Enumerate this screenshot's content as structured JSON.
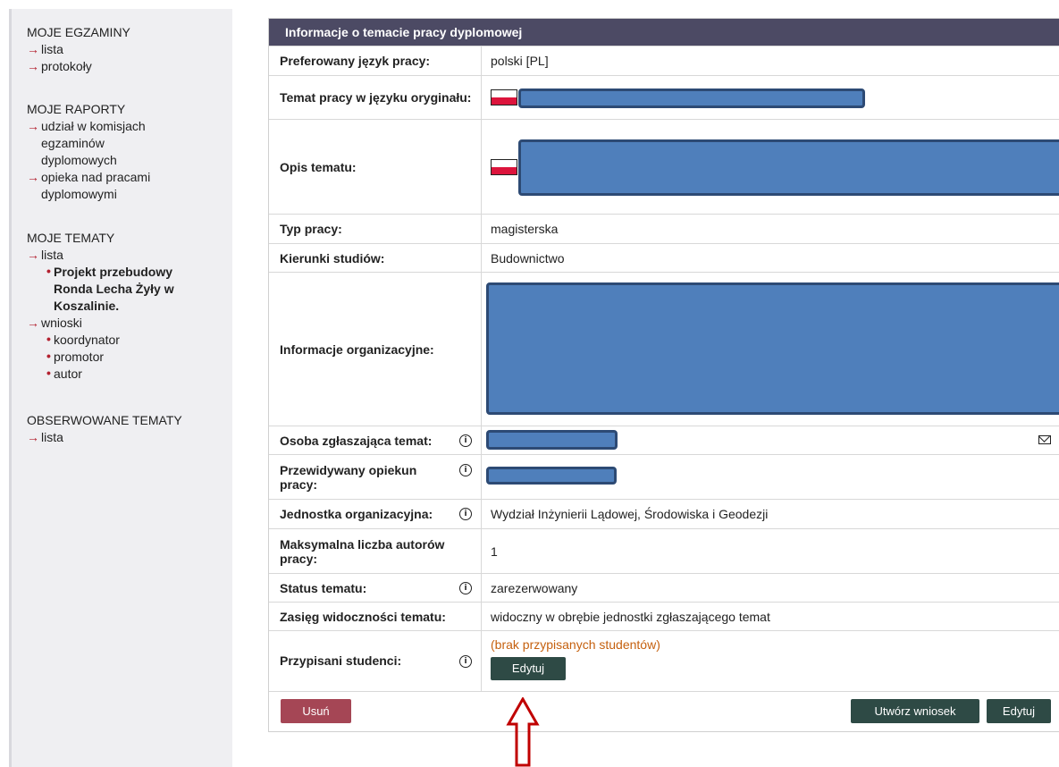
{
  "sidebar": {
    "sections": [
      {
        "title": "MOJE EGZAMINY",
        "links": [
          "lista",
          "protokoły"
        ]
      },
      {
        "title": "MOJE RAPORTY",
        "links": [
          "udział w komisjach egzaminów dyplomowych",
          "opieka nad pracami dyplomowymi"
        ]
      },
      {
        "title": "MOJE TEMATY",
        "link_lista": "lista",
        "current": "Projekt przebudowy Ronda Lecha Żyły w Koszalinie.",
        "link_wnioski": "wnioski",
        "subs": [
          "koordynator",
          "promotor",
          "autor"
        ]
      },
      {
        "title": "OBSERWOWANE TEMATY",
        "links": [
          "lista"
        ]
      }
    ],
    "raporty_lines": [
      "udział w komisjach",
      "egzaminów",
      "dyplomowych"
    ],
    "raporty_lines2": [
      "opieka nad pracami",
      "dyplomowymi"
    ],
    "current_lines": [
      "Projekt przebudowy",
      "Ronda Lecha Żyły w",
      "Koszalinie."
    ]
  },
  "panel": {
    "header": "Informacje o temacie pracy dyplomowej",
    "rows": {
      "jezyk": {
        "label": "Preferowany język pracy:",
        "value": "polski [PL]"
      },
      "temat": {
        "label": "Temat pracy w języku oryginału:"
      },
      "opis": {
        "label": "Opis tematu:"
      },
      "typ": {
        "label": "Typ pracy:",
        "value": "magisterska"
      },
      "kierunki": {
        "label": "Kierunki studiów:",
        "value": "Budownictwo"
      },
      "info_org": {
        "label": "Informacje organizacyjne:"
      },
      "osoba": {
        "label": "Osoba zgłaszająca temat:"
      },
      "opiekun": {
        "label": "Przewidywany opiekun pracy:"
      },
      "jednostka": {
        "label": "Jednostka organizacyjna:",
        "value": "Wydział Inżynierii Lądowej, Środowiska i Geodezji"
      },
      "max_autorow": {
        "label": "Maksymalna liczba autorów pracy:",
        "value": "1"
      },
      "status": {
        "label": "Status tematu:",
        "value": "zarezerwowany"
      },
      "zasieg": {
        "label": "Zasięg widoczności tematu:",
        "value": "widoczny w obrębie jednostki zgłaszającego temat"
      },
      "studenci": {
        "label": "Przypisani studenci:",
        "value": "(brak przypisanych studentów)",
        "button": "Edytuj"
      }
    },
    "footer": {
      "delete": "Usuń",
      "create_request": "Utwórz wniosek",
      "edit": "Edytuj"
    }
  },
  "colors": {
    "header_bg": "#4c4a64",
    "dark_button": "#2e4a45",
    "delete_button": "#a54655",
    "link_arrow": "#b3202f",
    "notice": "#c5600e",
    "redaction": "#4f7fbb",
    "annotation_arrow": "#c00000"
  }
}
